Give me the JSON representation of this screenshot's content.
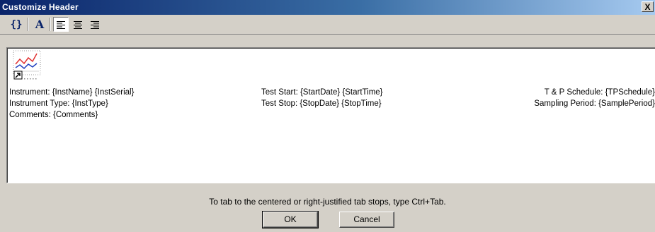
{
  "window": {
    "title": "Customize Header",
    "close_label": "X"
  },
  "toolbar": {
    "field_icon": "{}",
    "font_icon": "A",
    "align_left_icon": "align-left-icon",
    "align_center_icon": "align-center-icon",
    "align_right_icon": "align-right-icon"
  },
  "editor": {
    "rows": [
      {
        "left": "Instrument: {InstName} {InstSerial}",
        "center": "Test Start: {StartDate} {StartTime}",
        "right": "T & P Schedule: {TPSchedule}"
      },
      {
        "left": "Instrument Type: {InstType}",
        "center": "Test Stop: {StopDate} {StopTime}",
        "right": "Sampling Period: {SamplePeriod}"
      },
      {
        "left": "Comments: {Comments}",
        "center": "",
        "right": ""
      }
    ]
  },
  "hint": "To tab to the centered or right-justified tab stops, type Ctrl+Tab.",
  "buttons": {
    "ok": "OK",
    "cancel": "Cancel"
  }
}
